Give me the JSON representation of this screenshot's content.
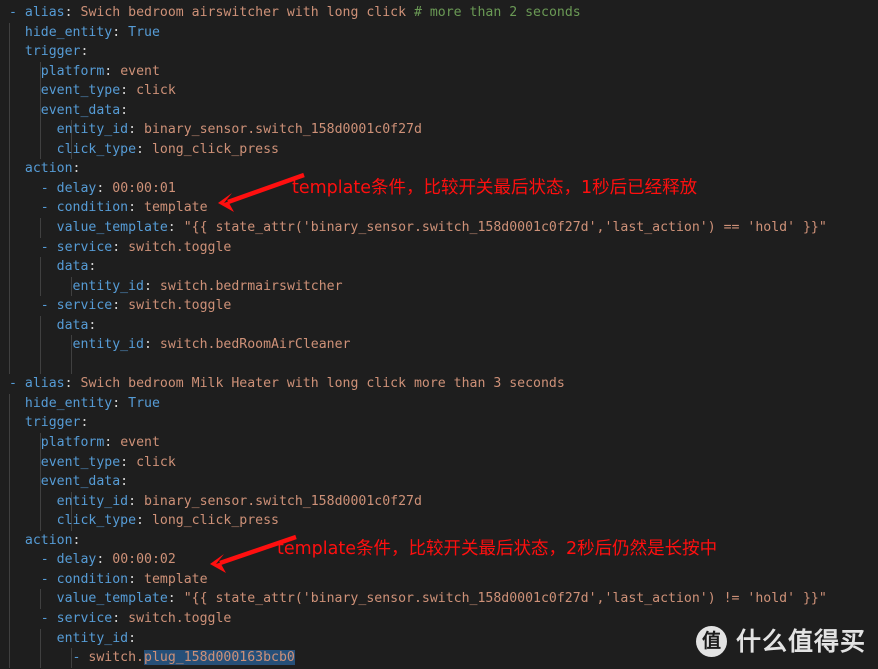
{
  "editor": {
    "background_color": "#1e1e1e",
    "language": "yaml",
    "colors": {
      "key": "#569cd6",
      "value": "#ce9178",
      "comment": "#6a9955",
      "punctuation": "#d4d4d4",
      "selection": "#264f78",
      "annotation": "#ff0f0f",
      "indent_guide": "#404040"
    }
  },
  "code": {
    "lines": [
      {
        "indent": 0,
        "dash": "- ",
        "key": "alias",
        "value": "Swich bedroom airswitcher with long click ",
        "comment": "# more than 2 seconds",
        "guides": []
      },
      {
        "indent": 1,
        "dash": "",
        "key": "hide_entity",
        "value": "True",
        "value_class": "k",
        "guides": [
          1
        ]
      },
      {
        "indent": 1,
        "dash": "",
        "key": "trigger",
        "value": "",
        "guides": [
          1
        ]
      },
      {
        "indent": 2,
        "dash": "",
        "key": "platform",
        "value": "event",
        "guides": [
          1,
          2
        ]
      },
      {
        "indent": 2,
        "dash": "",
        "key": "event_type",
        "value": "click",
        "guides": [
          1,
          2
        ]
      },
      {
        "indent": 2,
        "dash": "",
        "key": "event_data",
        "value": "",
        "guides": [
          1,
          2
        ]
      },
      {
        "indent": 3,
        "dash": "",
        "key": "entity_id",
        "value": "binary_sensor.switch_158d0001c0f27d",
        "guides": [
          1,
          2,
          3
        ]
      },
      {
        "indent": 3,
        "dash": "",
        "key": "click_type",
        "value": "long_click_press",
        "guides": [
          1,
          2,
          3
        ]
      },
      {
        "indent": 1,
        "dash": "",
        "key": "action",
        "value": "",
        "guides": [
          1
        ]
      },
      {
        "indent": 2,
        "dash": "- ",
        "key": "delay",
        "value": "00:00:01",
        "guides": [
          1
        ]
      },
      {
        "indent": 2,
        "dash": "- ",
        "key": "condition",
        "value": "template",
        "guides": [
          1
        ]
      },
      {
        "indent": 3,
        "dash": "",
        "key": "value_template",
        "value": "\"{{ state_attr('binary_sensor.switch_158d0001c0f27d','last_action') == 'hold' }}\"",
        "guides": [
          1,
          2
        ]
      },
      {
        "indent": 2,
        "dash": "- ",
        "key": "service",
        "value": "switch.toggle",
        "guides": [
          1
        ]
      },
      {
        "indent": 3,
        "dash": "",
        "key": "data",
        "value": "",
        "guides": [
          1,
          2
        ]
      },
      {
        "indent": 4,
        "dash": "",
        "key": "entity_id",
        "value": "switch.bedrmairswitcher",
        "guides": [
          1,
          2,
          3
        ]
      },
      {
        "indent": 2,
        "dash": "- ",
        "key": "service",
        "value": "switch.toggle",
        "guides": [
          1
        ]
      },
      {
        "indent": 3,
        "dash": "",
        "key": "data",
        "value": "",
        "guides": [
          1,
          2
        ]
      },
      {
        "indent": 4,
        "dash": "",
        "key": "entity_id",
        "value": "switch.bedRoomAirCleaner",
        "guides": [
          1,
          2,
          3
        ]
      },
      {
        "indent": 0,
        "dash": "",
        "key": "",
        "value": "",
        "guides": [
          1,
          2,
          3
        ]
      },
      {
        "indent": 0,
        "dash": "- ",
        "key": "alias",
        "value": "Swich bedroom Milk Heater with long click more than 3 seconds",
        "guides": []
      },
      {
        "indent": 1,
        "dash": "",
        "key": "hide_entity",
        "value": "True",
        "value_class": "k",
        "guides": [
          1
        ]
      },
      {
        "indent": 1,
        "dash": "",
        "key": "trigger",
        "value": "",
        "guides": [
          1
        ]
      },
      {
        "indent": 2,
        "dash": "",
        "key": "platform",
        "value": "event",
        "guides": [
          1,
          2
        ]
      },
      {
        "indent": 2,
        "dash": "",
        "key": "event_type",
        "value": "click",
        "guides": [
          1,
          2
        ]
      },
      {
        "indent": 2,
        "dash": "",
        "key": "event_data",
        "value": "",
        "guides": [
          1,
          2
        ]
      },
      {
        "indent": 3,
        "dash": "",
        "key": "entity_id",
        "value": "binary_sensor.switch_158d0001c0f27d",
        "guides": [
          1,
          2,
          3
        ]
      },
      {
        "indent": 3,
        "dash": "",
        "key": "click_type",
        "value": "long_click_press",
        "guides": [
          1,
          2,
          3
        ]
      },
      {
        "indent": 1,
        "dash": "",
        "key": "action",
        "value": "",
        "guides": [
          1
        ]
      },
      {
        "indent": 2,
        "dash": "- ",
        "key": "delay",
        "value": "00:00:02",
        "guides": [
          1
        ]
      },
      {
        "indent": 2,
        "dash": "- ",
        "key": "condition",
        "value": "template",
        "guides": [
          1
        ]
      },
      {
        "indent": 3,
        "dash": "",
        "key": "value_template",
        "value": "\"{{ state_attr('binary_sensor.switch_158d0001c0f27d','last_action') != 'hold' }}\"",
        "guides": [
          1,
          2
        ]
      },
      {
        "indent": 2,
        "dash": "- ",
        "key": "service",
        "value": "switch.toggle",
        "guides": [
          1
        ]
      },
      {
        "indent": 3,
        "dash": "",
        "key": "entity_id",
        "value": "",
        "guides": [
          1,
          2
        ]
      },
      {
        "indent": 4,
        "dash": "- ",
        "key": "",
        "value": "switch.plug_158d000163bcb0",
        "selected": "plug_158d000163bcb0",
        "guides": [
          1,
          2,
          3
        ]
      }
    ]
  },
  "annotations": [
    {
      "id": "annotation-1",
      "text": "template条件，比较开关最后状态，1秒后已经释放"
    },
    {
      "id": "annotation-2",
      "text": "template条件，比较开关最后状态，2秒后仍然是长按中"
    }
  ],
  "watermark": {
    "logo_text": "值",
    "text": "什么值得买"
  }
}
